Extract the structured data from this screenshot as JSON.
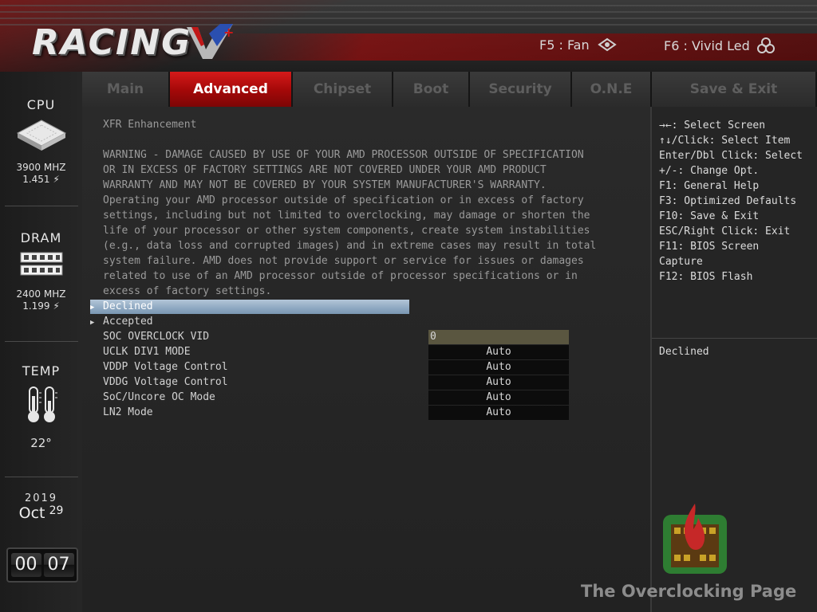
{
  "header": {
    "logo_text": "RACING",
    "fan_key": "F5 : Fan",
    "led_key": "F6 : Vivid Led"
  },
  "sidebar": {
    "cpu": {
      "title": "CPU",
      "freq": "3900 MHZ",
      "volt": "1.451 ⚡"
    },
    "dram": {
      "title": "DRAM",
      "freq": "2400 MHZ",
      "volt": "1.199 ⚡"
    },
    "temp": {
      "title": "TEMP",
      "value": "22°"
    },
    "date": {
      "year": "2019",
      "month": "Oct",
      "day": "29"
    },
    "clock": {
      "hours": "00",
      "minutes": "07"
    }
  },
  "tabs": [
    "Main",
    "Advanced",
    "Chipset",
    "Boot",
    "Security",
    "O.N.E",
    "Save & Exit"
  ],
  "active_tab": "Advanced",
  "main": {
    "heading": "XFR Enhancement",
    "warning_lines": [
      "WARNING - DAMAGE CAUSED BY USE OF YOUR AMD PROCESSOR OUTSIDE OF SPECIFICATION",
      "OR IN EXCESS OF FACTORY SETTINGS ARE NOT COVERED UNDER YOUR AMD PRODUCT",
      "WARRANTY AND MAY NOT BE COVERED BY YOUR SYSTEM MANUFACTURER'S WARRANTY.",
      "Operating your AMD processor outside of specification or in excess of factory",
      "settings, including but not limited to overclocking, may damage or shorten the",
      "life of your processor or other system components, create system instabilities",
      "(e.g., data loss and corrupted images) and in extreme cases may result in total",
      "system failure. AMD does not provide support or service for issues or damages",
      "related to use of an AMD processor outside of processor specifications or in",
      "excess of factory settings."
    ],
    "options": [
      {
        "label": "Declined",
        "selected": true
      },
      {
        "label": "Accepted",
        "selected": false
      }
    ],
    "settings": [
      {
        "label": "SOC OVERCLOCK VID",
        "value": "0"
      },
      {
        "label": "UCLK DIV1 MODE",
        "value": "Auto"
      },
      {
        "label": "VDDP Voltage Control",
        "value": "Auto"
      },
      {
        "label": "VDDG Voltage Control",
        "value": "Auto"
      },
      {
        "label": "SoC/Uncore OC Mode",
        "value": "Auto"
      },
      {
        "label": "LN2 Mode",
        "value": "Auto"
      }
    ]
  },
  "help": {
    "lines": [
      "→←: Select Screen",
      "↑↓/Click: Select Item",
      "Enter/Dbl Click: Select",
      "+/-: Change Opt.",
      "F1: General Help",
      "F3: Optimized Defaults",
      "F10: Save & Exit",
      "ESC/Right Click: Exit",
      "F11: BIOS Screen",
      "Capture",
      "F12: BIOS Flash"
    ],
    "item_description": "Declined"
  },
  "watermark": "The Overclocking Page",
  "colors": {
    "accent_red": "#b30d0d",
    "selection_blue": "#8ea8c1",
    "input_field": "#5a5640"
  }
}
